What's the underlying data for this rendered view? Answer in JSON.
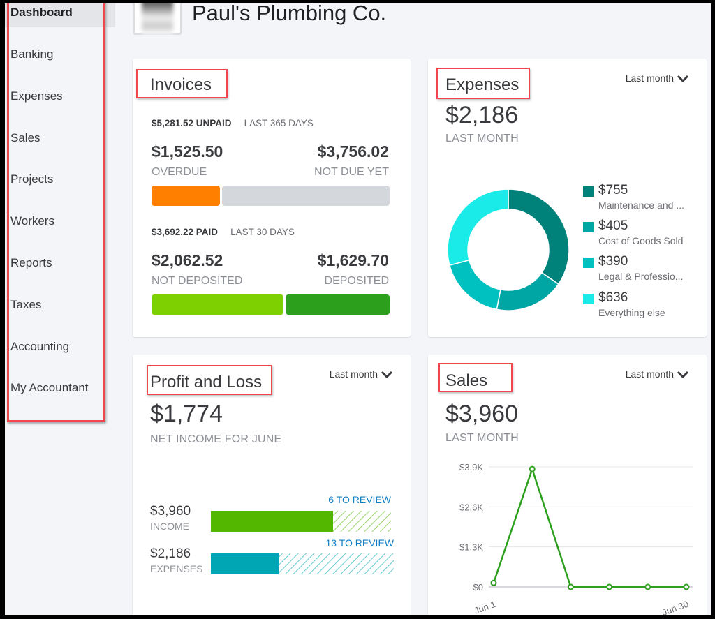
{
  "sidebar": {
    "items": [
      {
        "label": "Dashboard",
        "active": true
      },
      {
        "label": "Banking"
      },
      {
        "label": "Expenses"
      },
      {
        "label": "Sales"
      },
      {
        "label": "Projects"
      },
      {
        "label": "Workers"
      },
      {
        "label": "Reports"
      },
      {
        "label": "Taxes"
      },
      {
        "label": "Accounting"
      },
      {
        "label": "My Accountant"
      }
    ]
  },
  "header": {
    "company_name": "Paul's Plumbing Co."
  },
  "invoices": {
    "title": "Invoices",
    "unpaid_summary": "$5,281.52 UNPAID",
    "unpaid_period": "LAST 365 DAYS",
    "overdue_amount": "$1,525.50",
    "overdue_label": "OVERDUE",
    "not_due_amount": "$3,756.02",
    "not_due_label": "NOT DUE YET",
    "unpaid_bar": {
      "overdue_value": 1525.5,
      "not_due_value": 3756.02,
      "overdue_color": "#ff8000",
      "not_due_color": "#d4d7dc"
    },
    "paid_summary": "$3,692.22 PAID",
    "paid_period": "LAST 30 DAYS",
    "not_deposited_amount": "$2,062.52",
    "not_deposited_label": "NOT DEPOSITED",
    "deposited_amount": "$1,629.70",
    "deposited_label": "DEPOSITED",
    "paid_bar": {
      "not_deposited_value": 2062.52,
      "deposited_value": 1629.7,
      "not_deposited_color": "#7fd000",
      "deposited_color": "#2ca01c"
    }
  },
  "expenses": {
    "title": "Expenses",
    "period_selector": "Last month",
    "total": "$2,186",
    "total_label": "LAST MONTH",
    "chart_data": {
      "type": "pie",
      "variant": "donut",
      "slices": [
        {
          "label": "Maintenance and ...",
          "value": 755,
          "display": "$755",
          "color": "#00827a"
        },
        {
          "label": "Cost of Goods Sold",
          "value": 405,
          "display": "$405",
          "color": "#00a6a4"
        },
        {
          "label": "Legal & Professio...",
          "value": 390,
          "display": "$390",
          "color": "#00c1bf"
        },
        {
          "label": "Everything else",
          "value": 636,
          "display": "$636",
          "color": "#1aebe8"
        }
      ],
      "legend_placement": "right"
    }
  },
  "profit_loss": {
    "title": "Profit and Loss",
    "period_selector": "Last month",
    "net_income": "$1,774",
    "net_income_label": "NET INCOME FOR JUNE",
    "income": {
      "amount": "$3,960",
      "label": "INCOME",
      "review": "6 TO REVIEW",
      "solid_fraction": 0.68,
      "color": "#53b700"
    },
    "expenses_row": {
      "amount": "$2,186",
      "label": "EXPENSES",
      "review": "13 TO REVIEW",
      "solid_fraction": 0.37,
      "color": "#00a6b3"
    }
  },
  "sales": {
    "title": "Sales",
    "period_selector": "Last month",
    "total": "$3,960",
    "total_label": "LAST MONTH",
    "chart_data": {
      "type": "line",
      "x": [
        "Jun 1",
        "",
        "",
        "",
        "",
        "Jun 30"
      ],
      "x_tick_labels": [
        "Jun 1",
        "Jun 30"
      ],
      "series": [
        {
          "name": "Sales",
          "values": [
            130,
            3830,
            0,
            0,
            0,
            0
          ],
          "color": "#2ca01c"
        }
      ],
      "y_ticks": [
        "$0",
        "$1.3K",
        "$2.6K",
        "$3.9K"
      ],
      "y_tick_values": [
        0,
        1300,
        2600,
        3900
      ],
      "ylim": [
        0,
        3900
      ],
      "grid": true,
      "title": "",
      "xlabel": "",
      "ylabel": ""
    }
  }
}
